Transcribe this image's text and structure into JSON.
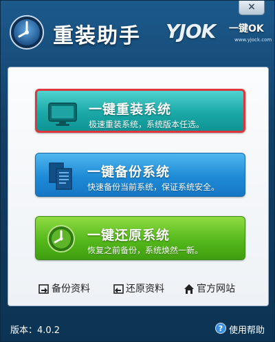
{
  "window": {
    "close_label": "×",
    "title": "重装助手",
    "brand": {
      "text": "YJOK",
      "tagline": "一键OK",
      "url": "www.yjock.com"
    }
  },
  "actions": [
    {
      "title": "一键重装系统",
      "desc": "极速重装系统，系统版本任选。",
      "icon": "monitor-icon",
      "color": "#1aa8a6",
      "selected": true
    },
    {
      "title": "一键备份系统",
      "desc": "快速备份当前系统，保证系统安全。",
      "icon": "documents-icon",
      "color": "#1e8bd6"
    },
    {
      "title": "一键还原系统",
      "desc": "恢复之前备份，系统焕然一新。",
      "icon": "clock-icon",
      "color": "#55b81c"
    }
  ],
  "links": [
    {
      "label": "备份资料",
      "icon": "backup-icon"
    },
    {
      "label": "还原资料",
      "icon": "restore-icon"
    },
    {
      "label": "官方网站",
      "icon": "home-icon"
    }
  ],
  "footer": {
    "version": "版本：4.0.2",
    "help_label": "使用帮助"
  },
  "colors": {
    "accent_border": "#e0353a",
    "window_bg": "#113f66"
  }
}
